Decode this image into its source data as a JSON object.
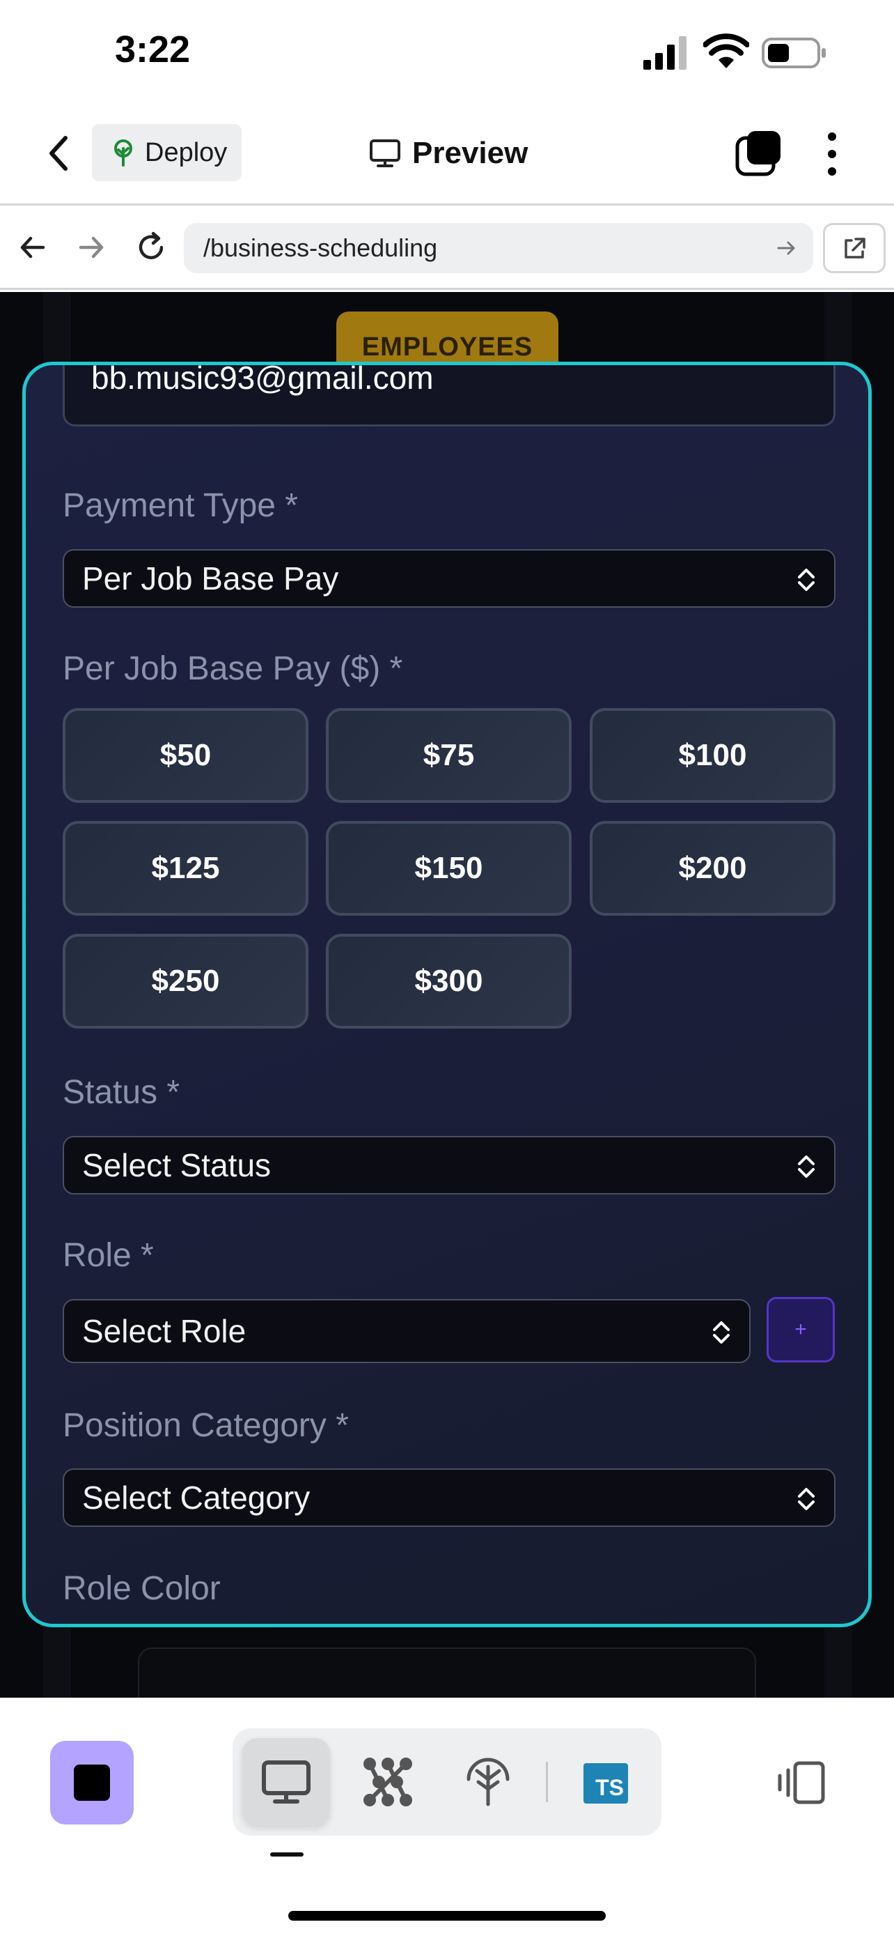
{
  "status_bar": {
    "time": "3:22"
  },
  "header": {
    "deploy_label": "Deploy",
    "title": "Preview"
  },
  "browser": {
    "url": "/business-scheduling"
  },
  "background": {
    "employees_tab": "EMPLOYEES"
  },
  "form": {
    "email_value": "bb.music93@gmail.com",
    "payment_type": {
      "label": "Payment Type *",
      "value": "Per Job Base Pay"
    },
    "base_pay": {
      "label": "Per Job Base Pay ($) *",
      "options": [
        "$50",
        "$75",
        "$100",
        "$125",
        "$150",
        "$200",
        "$250",
        "$300"
      ]
    },
    "status": {
      "label": "Status *",
      "value": "Select Status"
    },
    "role": {
      "label": "Role *",
      "value": "Select Role",
      "add_label": "+"
    },
    "position_category": {
      "label": "Position Category *",
      "value": "Select Category"
    },
    "role_color": {
      "label": "Role Color"
    }
  },
  "toolbar": {
    "ts_badge": "TS"
  },
  "colors": {
    "modal_border": "#1ec8cf",
    "stop_button": "#b4a3ff",
    "add_role_accent": "#5535c8"
  },
  "icons": [
    "back-chevron-icon",
    "deploy-tree-icon",
    "monitor-icon",
    "tabs-icon",
    "more-vertical-icon",
    "arrow-left-icon",
    "arrow-right-icon",
    "reload-icon",
    "open-external-icon",
    "select-chevron-icon",
    "stop-icon",
    "network-icon",
    "antenna-icon",
    "split-view-icon"
  ]
}
